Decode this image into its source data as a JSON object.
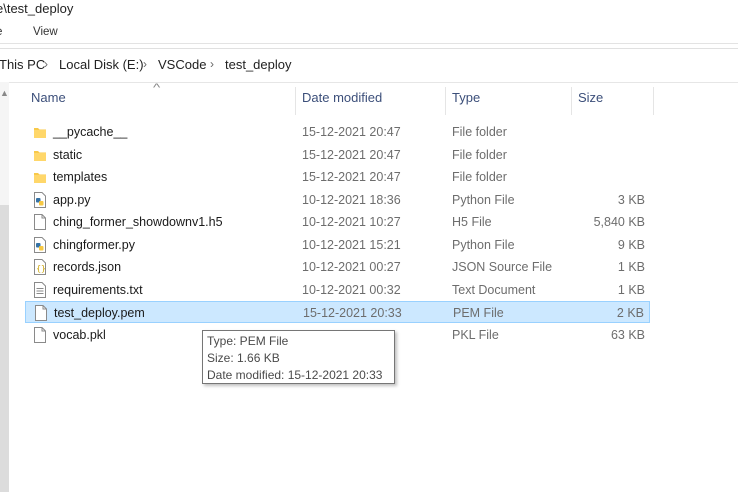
{
  "window": {
    "title": "e\\test_deploy"
  },
  "menu": {
    "file": "e",
    "view": "View"
  },
  "breadcrumb": [
    "This PC",
    "Local Disk (E:)",
    "VSCode",
    "test_deploy"
  ],
  "columns": {
    "name": "Name",
    "date": "Date modified",
    "type": "Type",
    "size": "Size"
  },
  "files": [
    {
      "name": "__pycache__",
      "date": "15-12-2021 20:47",
      "type": "File folder",
      "size": "",
      "icon": "folder-icon"
    },
    {
      "name": "static",
      "date": "15-12-2021 20:47",
      "type": "File folder",
      "size": "",
      "icon": "folder-icon"
    },
    {
      "name": "templates",
      "date": "15-12-2021 20:47",
      "type": "File folder",
      "size": "",
      "icon": "folder-icon"
    },
    {
      "name": "app.py",
      "date": "10-12-2021 18:36",
      "type": "Python File",
      "size": "3 KB",
      "icon": "python-file-icon"
    },
    {
      "name": "ching_former_showdownv1.h5",
      "date": "10-12-2021 10:27",
      "type": "H5 File",
      "size": "5,840 KB",
      "icon": "file-icon"
    },
    {
      "name": "chingformer.py",
      "date": "10-12-2021 15:21",
      "type": "Python File",
      "size": "9 KB",
      "icon": "python-file-icon"
    },
    {
      "name": "records.json",
      "date": "10-12-2021 00:27",
      "type": "JSON Source File",
      "size": "1 KB",
      "icon": "json-file-icon"
    },
    {
      "name": "requirements.txt",
      "date": "10-12-2021 00:32",
      "type": "Text Document",
      "size": "1 KB",
      "icon": "text-file-icon"
    },
    {
      "name": "test_deploy.pem",
      "date": "15-12-2021 20:33",
      "type": "PEM File",
      "size": "2 KB",
      "icon": "file-icon",
      "selected": true
    },
    {
      "name": "vocab.pkl",
      "date": "",
      "type": "PKL File",
      "size": "63 KB",
      "icon": "file-icon"
    }
  ],
  "tooltip": {
    "type": "Type: PEM File",
    "size": "Size: 1.66 KB",
    "date": "Date modified: 15-12-2021 20:33"
  },
  "colors": {
    "selection": "#cce8ff",
    "selection_border": "#99d1ff",
    "folder": "#f8c94a",
    "header_text": "#3c4f7a"
  }
}
